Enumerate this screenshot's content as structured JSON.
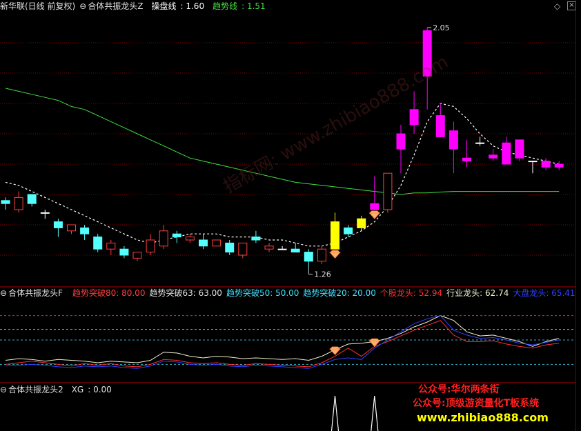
{
  "main_header": {
    "stock": "新华联(日线 前复权)",
    "indicator": "合体共振龙头Z",
    "cp_label": "操盘线",
    "cp_value": "1.60",
    "trend_label": "趋势线",
    "trend_value": "1.51"
  },
  "sub1_header": {
    "indicator": "合体共振龙头F",
    "items": [
      {
        "label": "趋势突破80",
        "value": "80.00",
        "color": "#ff4040"
      },
      {
        "label": "趋势突破63",
        "value": "63.00",
        "color": "#e0e0e0"
      },
      {
        "label": "趋势突破50",
        "value": "50.00",
        "color": "#40e0ff"
      },
      {
        "label": "趋势突破20",
        "value": "20.00",
        "color": "#40e0ff"
      },
      {
        "label": "个股龙头",
        "value": "52.94",
        "color": "#ff3030"
      },
      {
        "label": "行业龙头",
        "value": "62.74",
        "color": "#f0f0d0"
      },
      {
        "label": "大盘龙头",
        "value": "65.41",
        "color": "#3040ff"
      }
    ]
  },
  "sub2_header": {
    "indicator": "合体共振龙头2",
    "xg_label": "XG",
    "xg_value": "0.00"
  },
  "ad_lines": [
    "公众号:华尔两条街",
    "公众号:顶级游资量化T板系统",
    "www.zhibiao888.com"
  ],
  "watermark": "指标网: www.zhibiao888.com",
  "colors": {
    "up_yang": "#ff4040",
    "down_yin": "#54ffff",
    "strong_up": "#ff00ff",
    "signal_yellow": "#ffff00",
    "trend_white": "#ffffff",
    "ma_green": "#40e040",
    "grid_red": "#800000"
  },
  "chart_data": {
    "type": "candlestick",
    "price_annotations": {
      "high": "2.05",
      "low": "1.26"
    },
    "candles": [
      {
        "o": 1.47,
        "h": 1.49,
        "l": 1.45,
        "c": 1.48,
        "t": "down"
      },
      {
        "o": 1.45,
        "h": 1.51,
        "l": 1.44,
        "c": 1.49,
        "t": "up"
      },
      {
        "o": 1.5,
        "h": 1.5,
        "l": 1.46,
        "c": 1.47,
        "t": "down"
      },
      {
        "o": 1.44,
        "h": 1.45,
        "l": 1.42,
        "c": 1.44,
        "t": "doji"
      },
      {
        "o": 1.41,
        "h": 1.42,
        "l": 1.36,
        "c": 1.39,
        "t": "down"
      },
      {
        "o": 1.38,
        "h": 1.4,
        "l": 1.37,
        "c": 1.4,
        "t": "up"
      },
      {
        "o": 1.39,
        "h": 1.4,
        "l": 1.35,
        "c": 1.37,
        "t": "down"
      },
      {
        "o": 1.36,
        "h": 1.37,
        "l": 1.31,
        "c": 1.32,
        "t": "down"
      },
      {
        "o": 1.32,
        "h": 1.35,
        "l": 1.3,
        "c": 1.34,
        "t": "up"
      },
      {
        "o": 1.32,
        "h": 1.33,
        "l": 1.29,
        "c": 1.3,
        "t": "down"
      },
      {
        "o": 1.29,
        "h": 1.31,
        "l": 1.28,
        "c": 1.31,
        "t": "up"
      },
      {
        "o": 1.31,
        "h": 1.37,
        "l": 1.3,
        "c": 1.35,
        "t": "up"
      },
      {
        "o": 1.33,
        "h": 1.4,
        "l": 1.32,
        "c": 1.38,
        "t": "up"
      },
      {
        "o": 1.37,
        "h": 1.38,
        "l": 1.34,
        "c": 1.36,
        "t": "down"
      },
      {
        "o": 1.35,
        "h": 1.37,
        "l": 1.34,
        "c": 1.36,
        "t": "up"
      },
      {
        "o": 1.35,
        "h": 1.37,
        "l": 1.32,
        "c": 1.33,
        "t": "down"
      },
      {
        "o": 1.33,
        "h": 1.35,
        "l": 1.33,
        "c": 1.35,
        "t": "up"
      },
      {
        "o": 1.34,
        "h": 1.35,
        "l": 1.3,
        "c": 1.31,
        "t": "down"
      },
      {
        "o": 1.3,
        "h": 1.34,
        "l": 1.29,
        "c": 1.34,
        "t": "up"
      },
      {
        "o": 1.35,
        "h": 1.38,
        "l": 1.34,
        "c": 1.36,
        "t": "down"
      },
      {
        "o": 1.33,
        "h": 1.34,
        "l": 1.31,
        "c": 1.32,
        "t": "up"
      },
      {
        "o": 1.32,
        "h": 1.33,
        "l": 1.32,
        "c": 1.32,
        "t": "doji"
      },
      {
        "o": 1.32,
        "h": 1.34,
        "l": 1.31,
        "c": 1.31,
        "t": "down"
      },
      {
        "o": 1.31,
        "h": 1.32,
        "l": 1.26,
        "c": 1.28,
        "t": "down"
      },
      {
        "o": 1.28,
        "h": 1.33,
        "l": 1.27,
        "c": 1.32,
        "t": "up"
      },
      {
        "o": 1.32,
        "h": 1.44,
        "l": 1.32,
        "c": 1.41,
        "t": "signal"
      },
      {
        "o": 1.39,
        "h": 1.4,
        "l": 1.36,
        "c": 1.37,
        "t": "down"
      },
      {
        "o": 1.39,
        "h": 1.43,
        "l": 1.38,
        "c": 1.42,
        "t": "signal"
      },
      {
        "o": 1.45,
        "h": 1.56,
        "l": 1.45,
        "c": 1.47,
        "t": "strong"
      },
      {
        "o": 1.45,
        "h": 1.57,
        "l": 1.44,
        "c": 1.57,
        "t": "up"
      },
      {
        "o": 1.7,
        "h": 1.73,
        "l": 1.57,
        "c": 1.65,
        "t": "strong"
      },
      {
        "o": 1.78,
        "h": 1.84,
        "l": 1.7,
        "c": 1.73,
        "t": "strong"
      },
      {
        "o": 2.04,
        "h": 2.05,
        "l": 1.78,
        "c": 1.89,
        "t": "strong"
      },
      {
        "o": 1.76,
        "h": 1.8,
        "l": 1.69,
        "c": 1.69,
        "t": "strong"
      },
      {
        "o": 1.71,
        "h": 1.74,
        "l": 1.57,
        "c": 1.65,
        "t": "strong"
      },
      {
        "o": 1.61,
        "h": 1.68,
        "l": 1.59,
        "c": 1.62,
        "t": "strong"
      },
      {
        "o": 1.67,
        "h": 1.69,
        "l": 1.66,
        "c": 1.67,
        "t": "doji"
      },
      {
        "o": 1.63,
        "h": 1.65,
        "l": 1.61,
        "c": 1.62,
        "t": "strong"
      },
      {
        "o": 1.67,
        "h": 1.69,
        "l": 1.6,
        "c": 1.6,
        "t": "strong"
      },
      {
        "o": 1.68,
        "h": 1.68,
        "l": 1.61,
        "c": 1.62,
        "t": "strong"
      },
      {
        "o": 1.61,
        "h": 1.61,
        "l": 1.57,
        "c": 1.61,
        "t": "doji"
      },
      {
        "o": 1.61,
        "h": 1.62,
        "l": 1.58,
        "c": 1.59,
        "t": "strong"
      },
      {
        "o": 1.6,
        "h": 1.61,
        "l": 1.58,
        "c": 1.59,
        "t": "strong"
      }
    ],
    "ma_green": [
      1.85,
      1.84,
      1.83,
      1.82,
      1.81,
      1.79,
      1.78,
      1.76,
      1.74,
      1.72,
      1.7,
      1.68,
      1.66,
      1.64,
      1.62,
      1.61,
      1.6,
      1.59,
      1.58,
      1.57,
      1.56,
      1.55,
      1.54,
      1.535,
      1.53,
      1.525,
      1.52,
      1.515,
      1.51,
      1.505,
      1.5,
      1.505,
      1.505,
      1.508,
      1.51,
      1.51,
      1.51,
      1.51,
      1.51,
      1.51,
      1.51,
      1.51,
      1.51
    ],
    "trend_white": [
      1.54,
      1.53,
      1.51,
      1.49,
      1.47,
      1.45,
      1.43,
      1.41,
      1.39,
      1.37,
      1.35,
      1.34,
      1.35,
      1.36,
      1.37,
      1.37,
      1.37,
      1.36,
      1.36,
      1.36,
      1.35,
      1.35,
      1.34,
      1.33,
      1.33,
      1.34,
      1.36,
      1.38,
      1.41,
      1.46,
      1.53,
      1.63,
      1.74,
      1.8,
      1.79,
      1.75,
      1.7,
      1.66,
      1.64,
      1.63,
      1.62,
      1.61,
      1.6
    ],
    "diamond_markers": [
      25,
      28
    ],
    "sub1": {
      "levels": [
        80,
        63,
        50,
        20
      ],
      "line_white": [
        25,
        27,
        26,
        24,
        26,
        25,
        24,
        22,
        24,
        23,
        22,
        25,
        35,
        34,
        30,
        28,
        30,
        29,
        27,
        28,
        27,
        26,
        27,
        25,
        30,
        38,
        45,
        46,
        48,
        52,
        58,
        66,
        72,
        80,
        74,
        60,
        55,
        56,
        52,
        48,
        42,
        48,
        52
      ],
      "line_red": [
        20,
        22,
        24,
        22,
        20,
        18,
        21,
        19,
        21,
        18,
        17,
        20,
        26,
        25,
        22,
        21,
        22,
        20,
        19,
        21,
        20,
        19,
        18,
        17,
        22,
        30,
        40,
        30,
        42,
        48,
        55,
        62,
        68,
        74,
        56,
        48,
        48,
        49,
        45,
        42,
        40,
        44,
        46
      ],
      "line_blue": [
        18,
        19,
        20,
        19,
        17,
        16,
        18,
        17,
        18,
        16,
        15,
        18,
        24,
        23,
        20,
        19,
        20,
        18,
        17,
        19,
        18,
        17,
        16,
        15,
        20,
        26,
        28,
        26,
        40,
        50,
        60,
        70,
        76,
        80,
        62,
        56,
        52,
        53,
        50,
        46,
        44,
        47,
        50
      ]
    },
    "sub2": {
      "xg_spikes": [
        25,
        28
      ]
    }
  }
}
